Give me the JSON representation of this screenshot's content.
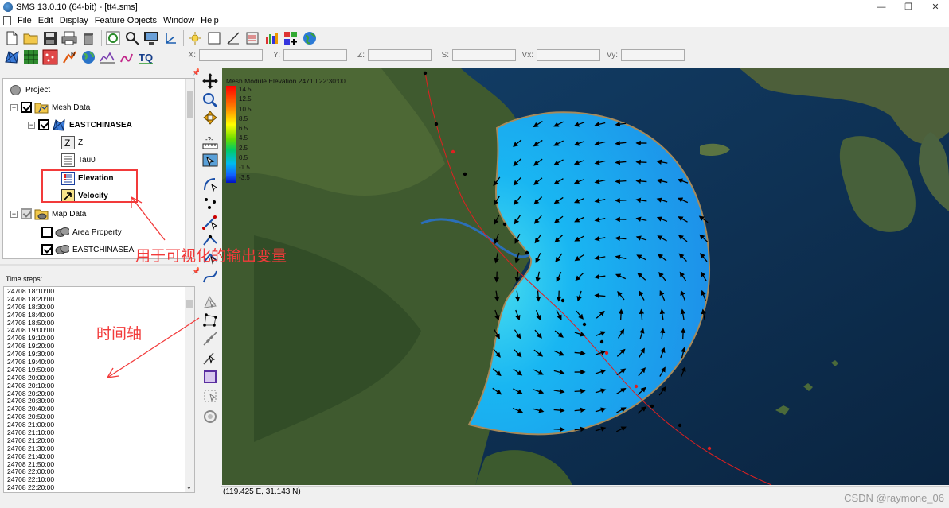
{
  "window": {
    "title": "SMS 13.0.10 (64-bit) - [tt4.sms]",
    "controls": [
      "—",
      "❐",
      "✕"
    ]
  },
  "menu": [
    "File",
    "Edit",
    "Display",
    "Feature Objects",
    "Window",
    "Help"
  ],
  "coords": {
    "x_label": "X:",
    "y_label": "Y:",
    "z_label": "Z:",
    "s_label": "S:",
    "vx_label": "Vx:",
    "vy_label": "Vy:"
  },
  "tree": {
    "project": "Project",
    "mesh_data": "Mesh Data",
    "mesh_name": "EASTCHINASEA",
    "z": "Z",
    "tau0": "Tau0",
    "elevation": "Elevation",
    "velocity": "Velocity",
    "map_data": "Map Data",
    "area_property": "Area Property",
    "map_cov": "EASTCHINASEA"
  },
  "timesteps": {
    "label": "Time steps:",
    "items": [
      "24708 18:10:00",
      "24708 18:20:00",
      "24708 18:30:00",
      "24708 18:40:00",
      "24708 18:50:00",
      "24708 19:00:00",
      "24708 19:10:00",
      "24708 19:20:00",
      "24708 19:30:00",
      "24708 19:40:00",
      "24708 19:50:00",
      "24708 20:00:00",
      "24708 20:10:00",
      "24708 20:20:00",
      "24708 20:30:00",
      "24708 20:40:00",
      "24708 20:50:00",
      "24708 21:00:00",
      "24708 21:10:00",
      "24708 21:20:00",
      "24708 21:30:00",
      "24708 21:40:00",
      "24708 21:50:00",
      "24708 22:00:00",
      "24708 22:10:00",
      "24708 22:20:00"
    ]
  },
  "legend": {
    "title": "Mesh Module Elevation 24710 22:30:00",
    "ticks": [
      "14.5",
      "12.5",
      "10.5",
      "8.5",
      "6.5",
      "4.5",
      "2.5",
      "0.5",
      "-1.5",
      "-3.5"
    ]
  },
  "annotations": {
    "output_vars": "用于可视化的输出变量",
    "timeline": "时间轴"
  },
  "status": {
    "coords": "(119.425 E, 31.143 N)"
  },
  "watermark": "CSDN @raymone_06",
  "colors": {
    "annotation": "#f23a3a",
    "sea_dark": "#0e2d4f",
    "mesh_cyan": "#19b4f0",
    "land": "#3f5a2f"
  }
}
